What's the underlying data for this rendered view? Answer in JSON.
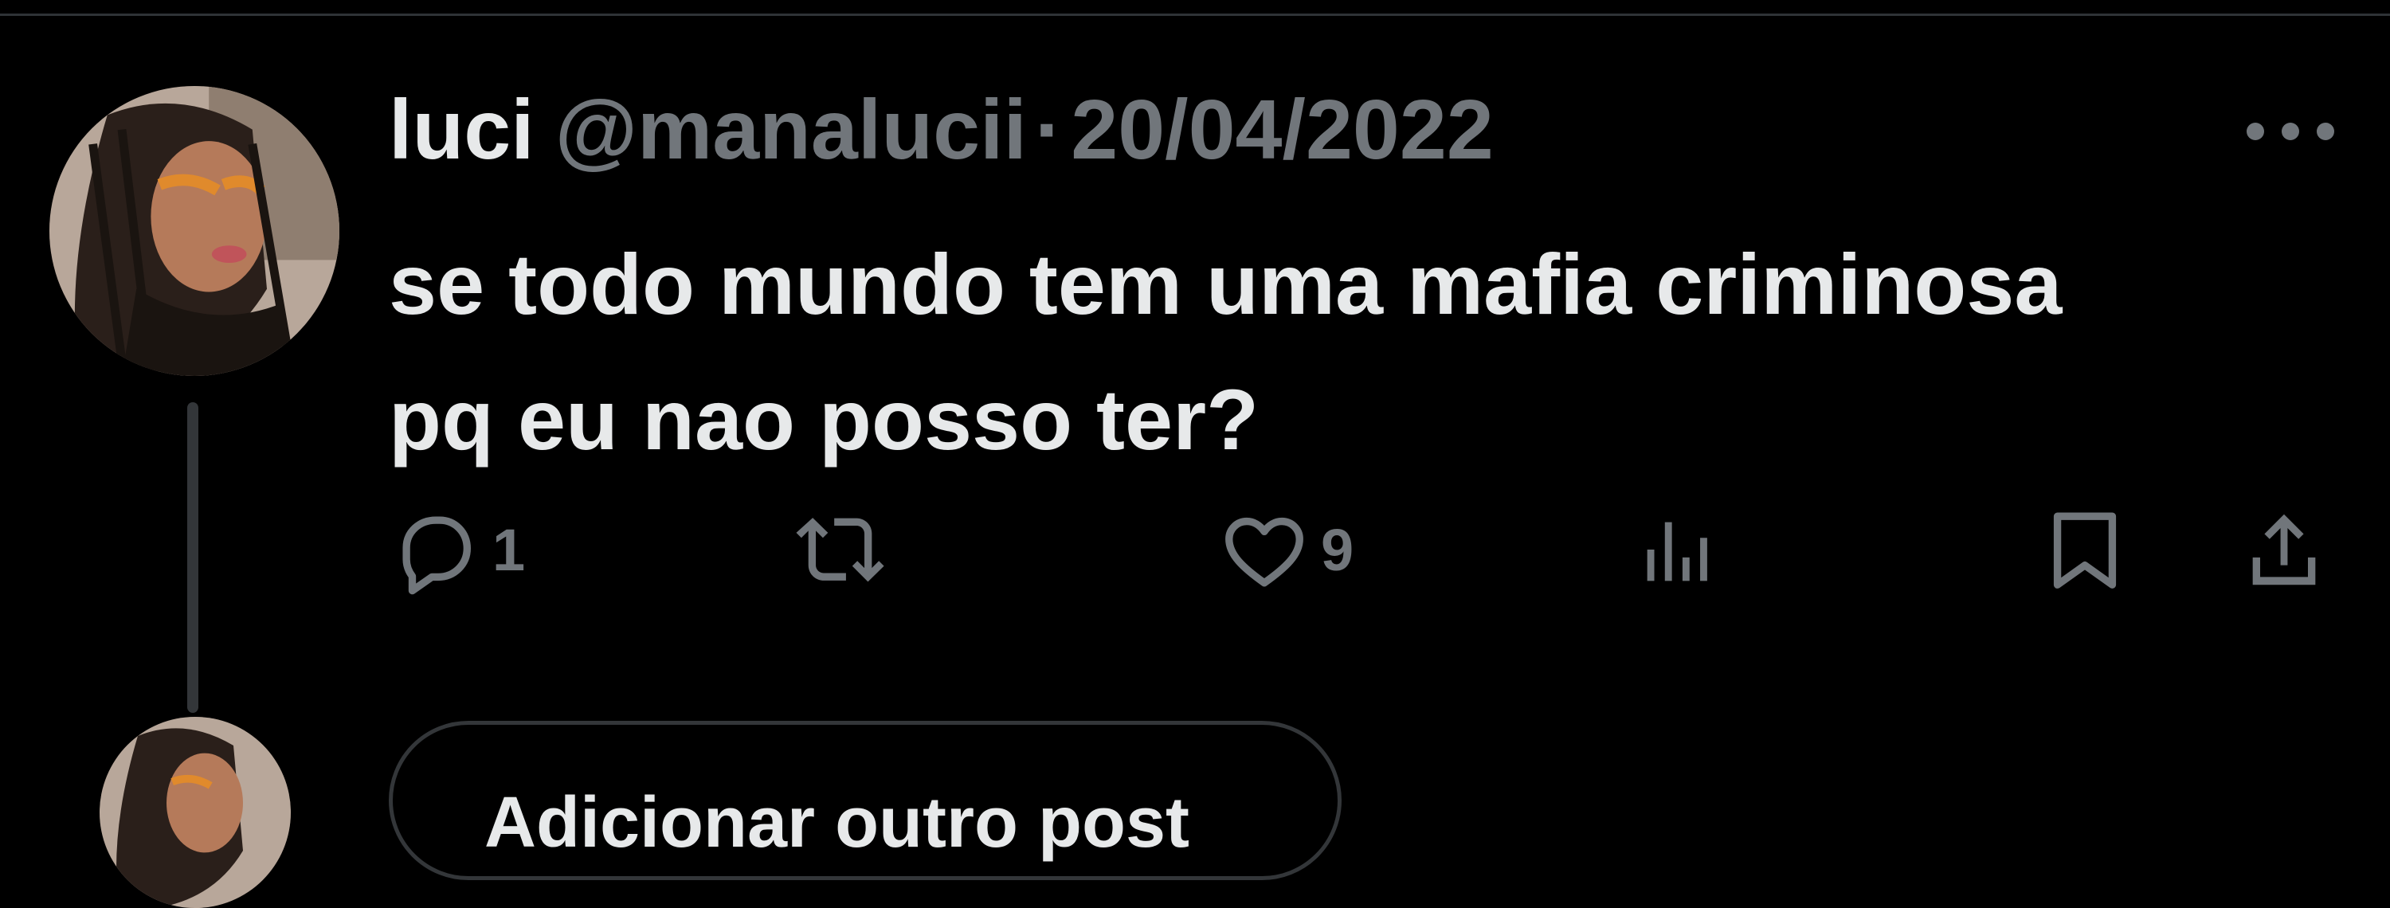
{
  "tweet": {
    "display_name": "luci",
    "handle": "@manalucii",
    "separator": "·",
    "date": "20/04/2022",
    "text_line1": "se todo mundo tem uma mafia criminosa",
    "text_line2": "pq eu nao posso ter?"
  },
  "actions": {
    "reply_count": "1",
    "like_count": "9"
  },
  "reply_composer": {
    "label": "Adicionar outro post"
  },
  "colors": {
    "background": "#000000",
    "text_primary": "#e7e9ea",
    "text_secondary": "#71767b",
    "border": "#2f3336"
  },
  "icons": {
    "more": "more-horizontal-icon",
    "reply": "reply-bubble-icon",
    "retweet": "retweet-icon",
    "like": "heart-icon",
    "views": "views-bars-icon",
    "bookmark": "bookmark-icon",
    "share": "share-icon"
  }
}
